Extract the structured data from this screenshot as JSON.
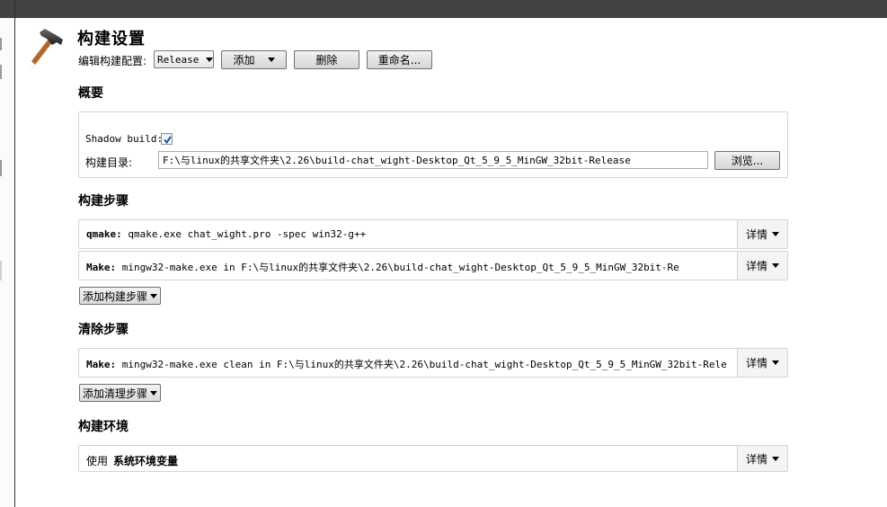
{
  "header": {
    "title": "构建设置",
    "config_label": "编辑构建配置:",
    "config_value": "Release",
    "add_label": "添加",
    "delete_label": "删除",
    "rename_label": "重命名..."
  },
  "summary": {
    "title": "概要",
    "shadow_build_label": "Shadow build:",
    "shadow_build_checked": true,
    "build_dir_label": "构建目录:",
    "build_dir_value": "F:\\与linux的共享文件夹\\2.26\\build-chat_wight-Desktop_Qt_5_9_5_MinGW_32bit-Release",
    "browse_label": "浏览..."
  },
  "build_steps": {
    "title": "构建步骤",
    "steps": [
      {
        "name": "qmake:",
        "command": "qmake.exe chat_wight.pro -spec win32-g++",
        "details_label": "详情"
      },
      {
        "name": "Make:",
        "command": "mingw32-make.exe in F:\\与linux的共享文件夹\\2.26\\build-chat_wight-Desktop_Qt_5_9_5_MinGW_32bit-Re",
        "details_label": "详情"
      }
    ],
    "add_label": "添加构建步骤"
  },
  "clean_steps": {
    "title": "清除步骤",
    "steps": [
      {
        "name": "Make:",
        "command": "mingw32-make.exe clean in F:\\与linux的共享文件夹\\2.26\\build-chat_wight-Desktop_Qt_5_9_5_MinGW_32bit-Rele",
        "details_label": "详情"
      }
    ],
    "add_label": "添加清理步骤"
  },
  "environment": {
    "title": "构建环境",
    "use_label": "使用",
    "value": "系统环境变量",
    "details_label": "详情"
  },
  "icons": {
    "header_icon": "hammer-icon"
  }
}
